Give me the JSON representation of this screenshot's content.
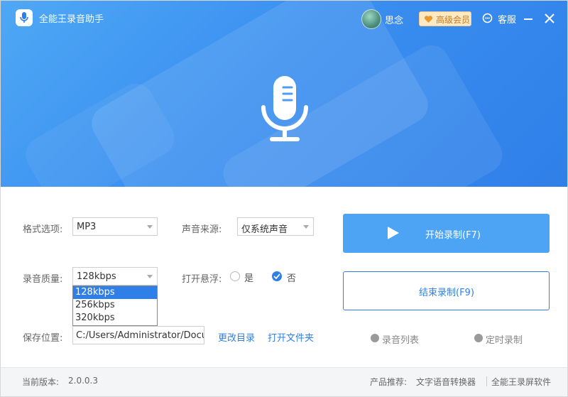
{
  "app": {
    "title": "全能王录音助手"
  },
  "header": {
    "username": "思念",
    "vip_label": "高级会员",
    "service_label": "客服"
  },
  "form": {
    "format": {
      "label": "格式选项:",
      "value": "MP3"
    },
    "source": {
      "label": "声音来源:",
      "value": "仅系统声音"
    },
    "quality": {
      "label": "录音质量:",
      "value": "128kbps",
      "options": [
        "128kbps",
        "256kbps",
        "320kbps"
      ],
      "selected_index": 0
    },
    "floating": {
      "label": "打开悬浮:",
      "options": [
        "是",
        "否"
      ],
      "selected": "否"
    },
    "save": {
      "label": "保存位置:",
      "value": "C:/Users/Administrator/Documents"
    },
    "change_dir": "更改目录",
    "open_folder": "打开文件夹"
  },
  "actions": {
    "start": "开始录制(F7)",
    "stop": "结束录制(F9)",
    "record_list": "录音列表",
    "scheduled": "定时录制"
  },
  "footer": {
    "version_label": "当前版本:",
    "version": "2.0.0.3",
    "recommend_label": "产品推荐:",
    "product1": "文字语音转换器",
    "product2": "全能王录屏软件"
  },
  "colors": {
    "primary": "#2f7fe8",
    "button_light": "#4ea4f4",
    "vip": "#fde9c4"
  },
  "icons": [
    "microphone-icon",
    "heart-icon",
    "headset-icon",
    "minimize-icon",
    "close-icon",
    "play-icon",
    "list-icon",
    "clock-icon"
  ]
}
